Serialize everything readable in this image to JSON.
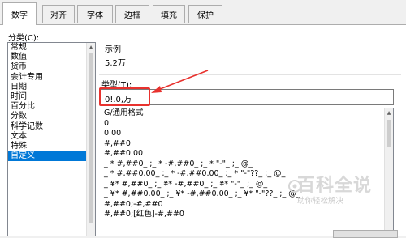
{
  "tabs": [
    {
      "label": "数字",
      "active": true
    },
    {
      "label": "对齐",
      "active": false
    },
    {
      "label": "字体",
      "active": false
    },
    {
      "label": "边框",
      "active": false
    },
    {
      "label": "填充",
      "active": false
    },
    {
      "label": "保护",
      "active": false
    }
  ],
  "category": {
    "label": "分类(C):",
    "items": [
      "常规",
      "数值",
      "货币",
      "会计专用",
      "日期",
      "时间",
      "百分比",
      "分数",
      "科学记数",
      "文本",
      "特殊",
      "自定义"
    ],
    "selected": "自定义"
  },
  "sample": {
    "label": "示例",
    "value": "5.2万"
  },
  "type": {
    "label": "类型(T):",
    "value": "0!.0,万"
  },
  "formats": [
    "G/通用格式",
    "0",
    "0.00",
    "#,##0",
    "#,##0.00",
    "_ * #,##0_ ;_ * -#,##0_ ;_ * \"-\"_ ;_ @_",
    "_ * #,##0.00_ ;_ * -#,##0.00_ ;_ * \"-\"??_ ;_ @_",
    "_ ¥* #,##0_ ;_ ¥* -#,##0_ ;_ ¥* \"-\"_ ;_ @_",
    "_ ¥* #,##0.00_ ;_ ¥* -#,##0.00_ ;_ ¥* \"-\"??_ ;_ @_",
    "#,##0;-#,##0",
    "#,##0;[红色]-#,##0"
  ],
  "watermark": {
    "title": "百科全说",
    "subtitle": "助你轻松解决"
  },
  "colors": {
    "highlight": "#e8322e",
    "selection": "#0078d7"
  }
}
